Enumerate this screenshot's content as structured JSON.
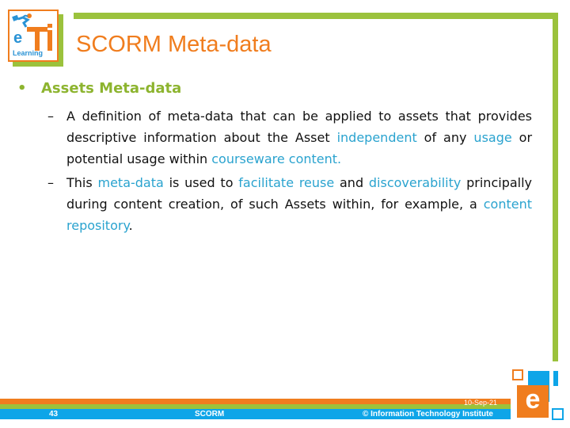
{
  "slide": {
    "title": "SCORM Meta-data",
    "logo": {
      "letter_e": "e",
      "text": "Learning",
      "icon": "runner-eti-logo-icon"
    },
    "bullet": {
      "glyph": "•",
      "heading": "Assets Meta-data",
      "subitems": [
        {
          "dash": "–",
          "segments": [
            {
              "text": "A definition of meta-data that can be applied to assets that provides descriptive information about the Asset ",
              "highlight": false
            },
            {
              "text": "independent",
              "highlight": true
            },
            {
              "text": " of any ",
              "highlight": false
            },
            {
              "text": "usage",
              "highlight": true
            },
            {
              "text": " or potential usage within ",
              "highlight": false
            },
            {
              "text": "courseware content.",
              "highlight": true
            }
          ]
        },
        {
          "dash": "–",
          "segments": [
            {
              "text": "This ",
              "highlight": false
            },
            {
              "text": "meta-data",
              "highlight": true
            },
            {
              "text": " is used to ",
              "highlight": false
            },
            {
              "text": "facilitate reuse",
              "highlight": true
            },
            {
              "text": " and ",
              "highlight": false
            },
            {
              "text": "discoverability",
              "highlight": true
            },
            {
              "text": " principally during content creation, of such Assets within, for example, a ",
              "highlight": false
            },
            {
              "text": "content repository",
              "highlight": true
            },
            {
              "text": ".",
              "highlight": false
            }
          ]
        }
      ]
    }
  },
  "footer": {
    "slide_number": "43",
    "label": "SCORM",
    "date": "10-Sep-21",
    "copyright": "© Information Technology Institute",
    "corner_logo_letter": "e"
  },
  "colors": {
    "orange": "#f07d1e",
    "green": "#9bc23c",
    "blue": "#0ea5e8",
    "highlight_text": "#2aa3cf",
    "heading_green": "#8db42f"
  }
}
